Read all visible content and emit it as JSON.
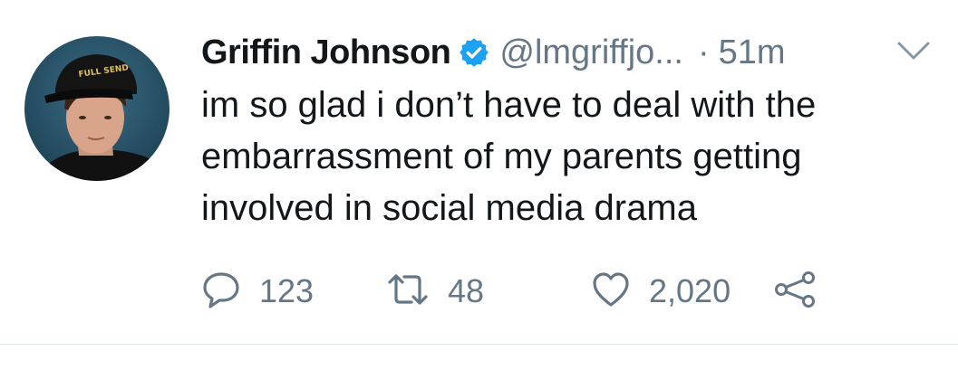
{
  "tweet": {
    "display_name": "Griffin Johnson",
    "handle": "@lmgriffjo...",
    "separator": "·",
    "time": "51m",
    "text_lines": [
      "im so glad i don’t have to deal with the",
      "embarrassment of my parents getting",
      "involved in social media drama"
    ],
    "avatar_cap_text": "FULL SEND",
    "actions": {
      "replies": "123",
      "retweets": "48",
      "likes": "2,020"
    }
  },
  "icons": {
    "verified": "verified-badge-icon",
    "menu": "chevron-down-icon",
    "reply": "reply-icon",
    "retweet": "retweet-icon",
    "like": "heart-icon",
    "share": "share-icon"
  },
  "colors": {
    "text": "#14171a",
    "secondary": "#657786",
    "verified": "#1da1f2",
    "divider": "#e1e8ed"
  }
}
